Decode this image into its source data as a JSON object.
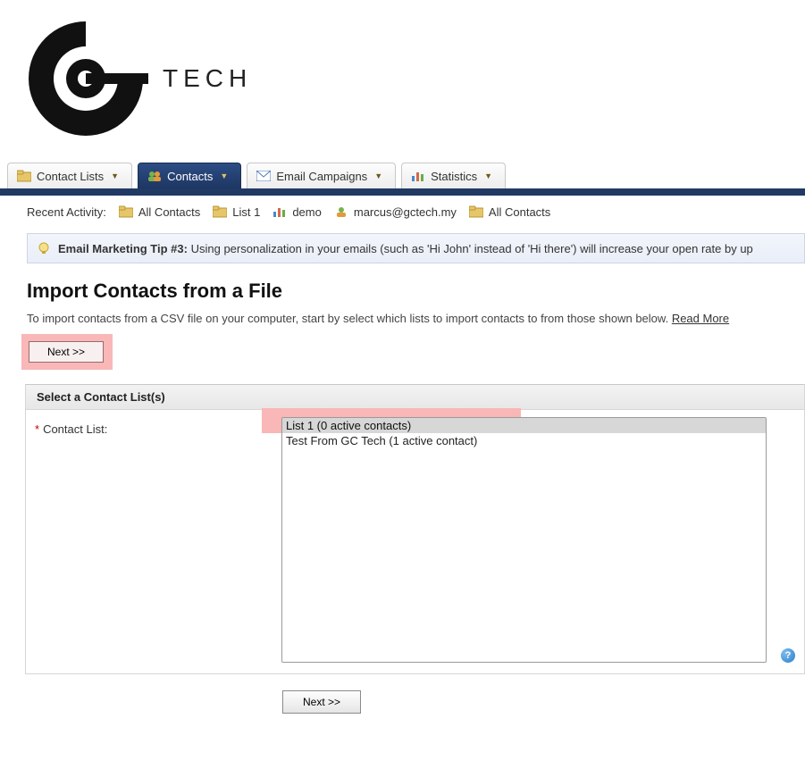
{
  "logo": {
    "text": "TECH"
  },
  "tabs": [
    {
      "label": "Contact Lists"
    },
    {
      "label": "Contacts"
    },
    {
      "label": "Email Campaigns"
    },
    {
      "label": "Statistics"
    }
  ],
  "recent": {
    "label": "Recent Activity:",
    "items": [
      {
        "label": "All Contacts",
        "icon": "folder"
      },
      {
        "label": "List 1",
        "icon": "folder"
      },
      {
        "label": "demo",
        "icon": "chart"
      },
      {
        "label": "marcus@gctech.my",
        "icon": "user"
      },
      {
        "label": "All Contacts",
        "icon": "folder"
      }
    ]
  },
  "tip": {
    "title": "Email Marketing Tip #3:",
    "text": "Using personalization in your emails (such as 'Hi John' instead of 'Hi there') will increase your open rate by up"
  },
  "page": {
    "title": "Import Contacts from a File",
    "intro": "To import contacts from a CSV file on your computer, start by select which lists to import contacts to from those shown below.",
    "read_more": "Read More"
  },
  "buttons": {
    "next_top": "Next >>",
    "next_bottom": "Next >>"
  },
  "section": {
    "header": "Select a Contact List(s)",
    "field_label": "Contact List:",
    "options": [
      "List 1 (0 active contacts)",
      "Test From GC Tech (1 active contact)"
    ]
  }
}
